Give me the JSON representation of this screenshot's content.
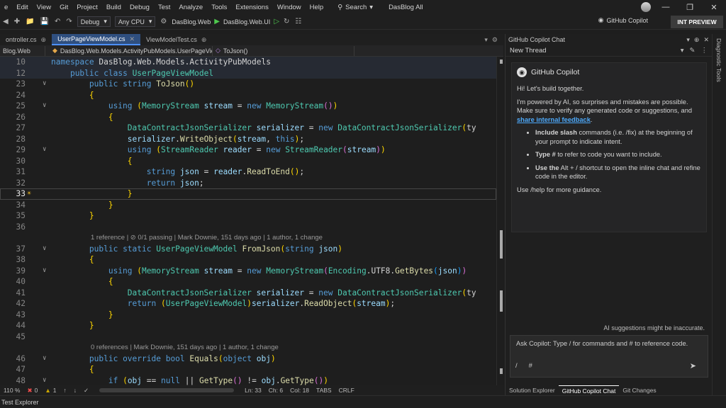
{
  "menu": [
    "e",
    "Edit",
    "View",
    "Git",
    "Project",
    "Build",
    "Debug",
    "Test",
    "Analyze",
    "Tools",
    "Extensions",
    "Window",
    "Help"
  ],
  "search_label": "Search",
  "solution_name": "DasBlog All",
  "toolbar": {
    "config": "Debug",
    "platform": "Any CPU",
    "startup_project": "DasBlog.Web",
    "run_target": "DasBlog.Web.UI",
    "copilot_label": "GitHub Copilot",
    "int_preview": "INT PREVIEW"
  },
  "editor_tabs": [
    {
      "label": "ontroller.cs",
      "active": false
    },
    {
      "label": "UserPageViewModel.cs",
      "active": true
    },
    {
      "label": "ViewModelTest.cs",
      "active": false
    }
  ],
  "navbar": {
    "project": "Blog.Web",
    "type": "DasBlog.Web.Models.ActivityPubModels.UserPageViewMo",
    "member": "ToJson()"
  },
  "code_lines": [
    {
      "ln": "10",
      "kind": "code",
      "sticky": true,
      "fold": false
    },
    {
      "ln": "12",
      "kind": "code",
      "sticky": true,
      "fold": false
    },
    {
      "ln": "23",
      "kind": "code",
      "fold": true
    },
    {
      "ln": "24",
      "kind": "code"
    },
    {
      "ln": "25",
      "kind": "code",
      "fold": true
    },
    {
      "ln": "26",
      "kind": "code"
    },
    {
      "ln": "27",
      "kind": "code"
    },
    {
      "ln": "28",
      "kind": "code"
    },
    {
      "ln": "29",
      "kind": "code",
      "fold": true
    },
    {
      "ln": "30",
      "kind": "code"
    },
    {
      "ln": "31",
      "kind": "code"
    },
    {
      "ln": "32",
      "kind": "code"
    },
    {
      "ln": "33",
      "kind": "code",
      "current": true
    },
    {
      "ln": "34",
      "kind": "code"
    },
    {
      "ln": "35",
      "kind": "code"
    },
    {
      "ln": "36",
      "kind": "code"
    },
    {
      "ln": "",
      "kind": "lens"
    },
    {
      "ln": "37",
      "kind": "code",
      "fold": true
    },
    {
      "ln": "38",
      "kind": "code"
    },
    {
      "ln": "39",
      "kind": "code",
      "fold": true
    },
    {
      "ln": "40",
      "kind": "code"
    },
    {
      "ln": "41",
      "kind": "code"
    },
    {
      "ln": "42",
      "kind": "code"
    },
    {
      "ln": "43",
      "kind": "code"
    },
    {
      "ln": "44",
      "kind": "code"
    },
    {
      "ln": "45",
      "kind": "code"
    },
    {
      "ln": "",
      "kind": "lens"
    },
    {
      "ln": "46",
      "kind": "code",
      "fold": true
    },
    {
      "ln": "47",
      "kind": "code"
    },
    {
      "ln": "48",
      "kind": "code",
      "fold": true
    }
  ],
  "code_text": [
    "namespace DasBlog.Web.Models.ActivityPubModels",
    "    public class UserPageViewModel",
    "        public string ToJson()",
    "        {",
    "            using (MemoryStream stream = new MemoryStream())",
    "            {",
    "                DataContractJsonSerializer serializer = new DataContractJsonSerializer(ty",
    "                serializer.WriteObject(stream, this);",
    "                using (StreamReader reader = new StreamReader(stream))",
    "                {",
    "                    string json = reader.ReadToEnd();",
    "                    return json;",
    "                }",
    "            }",
    "        }",
    "",
    "1 reference | ⊘ 0/1 passing | Mark Downie, 151 days ago | 1 author, 1 change",
    "        public static UserPageViewModel FromJson(string json)",
    "        {",
    "            using (MemoryStream stream = new MemoryStream(Encoding.UTF8.GetBytes(json))",
    "            {",
    "                DataContractJsonSerializer serializer = new DataContractJsonSerializer(ty",
    "                return (UserPageViewModel)serializer.ReadObject(stream);",
    "            }",
    "        }",
    "",
    "0 references | Mark Downie, 151 days ago | 1 author, 1 change",
    "        public override bool Equals(object obj)",
    "        {",
    "            if (obj == null || GetType() != obj.GetType())"
  ],
  "editor_status": {
    "zoom": "110 %",
    "errors": "0",
    "warnings": "1",
    "line": "Ln: 33",
    "col": "Ch: 6",
    "col2": "Col: 18",
    "tabs": "TABS",
    "eol": "CRLF"
  },
  "bottom_status": "Test Explorer",
  "copilot": {
    "panel_title": "GitHub Copilot Chat",
    "thread": "New Thread",
    "name": "GitHub Copilot",
    "greeting": "Hi! Let's build together.",
    "intro": "I'm powered by AI, so surprises and mistakes are possible. Make sure to verify any generated code or suggestions, and",
    "feedback_link": "share internal feedback",
    "tips": [
      {
        "bold": "Include slash",
        "rest": " commands (i.e. /fix) at the beginning of your prompt to indicate intent."
      },
      {
        "bold": "Type #",
        "rest": " to refer to code you want to include."
      },
      {
        "bold": "Use the",
        "rest": " Alt + / shortcut to open the inline chat and refine code in the editor."
      }
    ],
    "help": "Use /help for more guidance.",
    "disclaimer": "AI suggestions might be inaccurate.",
    "input_placeholder": "Ask Copilot: Type / for commands and # to reference code.",
    "tabs": [
      "Solution Explorer",
      "GitHub Copilot Chat",
      "Git Changes"
    ],
    "active_tab": 1
  },
  "right_rail_label": "Diagnostic Tools"
}
